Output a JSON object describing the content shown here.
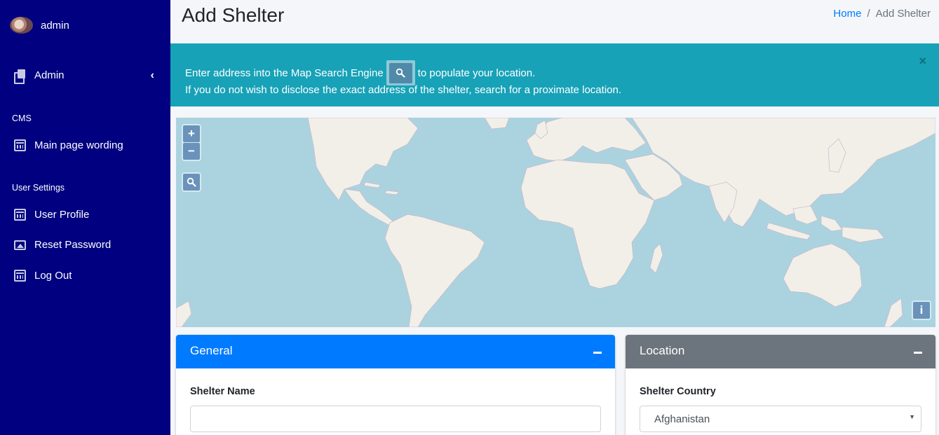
{
  "sidebar": {
    "user": {
      "name": "admin"
    },
    "menu": [
      {
        "label": "Admin",
        "icon": "copy-icon"
      }
    ],
    "sections": [
      {
        "header": "CMS",
        "items": [
          {
            "label": "Main page wording",
            "icon": "calendar-icon"
          }
        ]
      },
      {
        "header": "User Settings",
        "items": [
          {
            "label": "User Profile",
            "icon": "calendar-icon"
          },
          {
            "label": "Reset Password",
            "icon": "image-icon"
          },
          {
            "label": "Log Out",
            "icon": "calendar-icon"
          }
        ]
      }
    ]
  },
  "header": {
    "title": "Add Shelter",
    "breadcrumb": [
      "Home",
      "Add Shelter"
    ],
    "breadcrumb_separator": "/"
  },
  "alert": {
    "line1_before": "Enter address into the Map Search Engine",
    "line1_after": "to populate your location.",
    "line2": "If you do not wish to disclose the exact address of the shelter, search for a proximate location.",
    "close_label": "×",
    "color": "#17a2b8"
  },
  "map": {
    "zoom_in_label": "+",
    "zoom_out_label": "−",
    "info_label": "i",
    "water_color": "#aad3df",
    "land_color": "#f2efe9"
  },
  "cards": {
    "general": {
      "title": "General",
      "color": "#007bff",
      "collapse_icon": "minus-icon",
      "fields": [
        {
          "label": "Shelter Name",
          "value": "",
          "placeholder": ""
        }
      ]
    },
    "location": {
      "title": "Location",
      "color": "#6c757d",
      "collapse_icon": "minus-icon",
      "fields": [
        {
          "label": "Shelter Country",
          "value": "Afghanistan"
        }
      ]
    }
  },
  "colors": {
    "sidebar_bg": "#000080",
    "primary": "#007bff"
  }
}
